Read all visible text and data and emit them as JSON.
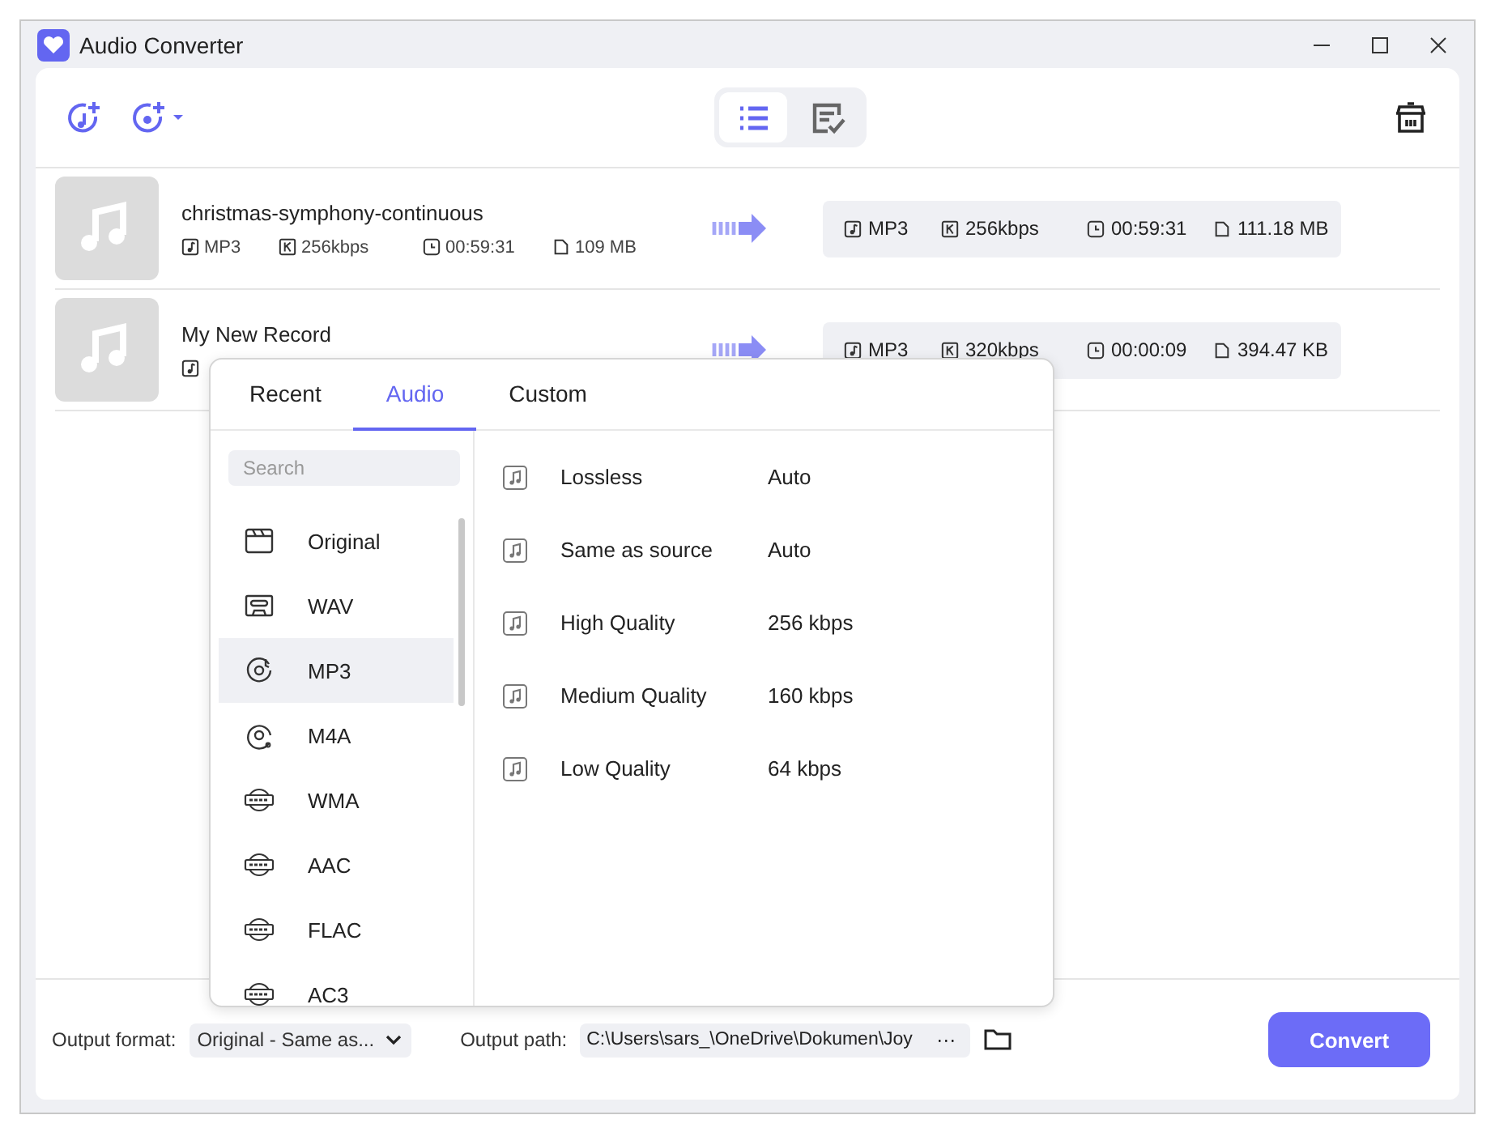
{
  "window": {
    "title": "Audio Converter"
  },
  "view_toggle": [
    {
      "kind": "list",
      "selected": true
    },
    {
      "kind": "tasks",
      "selected": false
    }
  ],
  "files": [
    {
      "name": "christmas-symphony-continuous",
      "source": [
        {
          "kind": "format",
          "text": "MP3"
        },
        {
          "kind": "bitrate",
          "text": "256kbps"
        },
        {
          "kind": "duration",
          "text": "00:59:31"
        },
        {
          "kind": "size",
          "text": "109 MB"
        }
      ],
      "target": [
        {
          "kind": "format",
          "text": "MP3"
        },
        {
          "kind": "bitrate",
          "text": "256kbps"
        },
        {
          "kind": "duration",
          "text": "00:59:31"
        },
        {
          "kind": "size",
          "text": "111.18 MB"
        }
      ]
    },
    {
      "name": "My New Record",
      "source": [
        {
          "kind": "format"
        }
      ],
      "target": [
        {
          "kind": "format",
          "text": "MP3"
        },
        {
          "kind": "bitrate",
          "text": "320kbps"
        },
        {
          "kind": "duration",
          "text": "00:00:09"
        },
        {
          "kind": "size",
          "text": "394.47 KB"
        }
      ]
    }
  ],
  "format_popup": {
    "tabs": [
      {
        "label": "Recent",
        "selected": false
      },
      {
        "label": "Audio",
        "selected": true
      },
      {
        "label": "Custom",
        "selected": false
      }
    ],
    "search": {
      "placeholder": "Search"
    },
    "formats": [
      {
        "label": "Original",
        "kind": "clapper",
        "selected": false
      },
      {
        "label": "WAV",
        "kind": "cassette",
        "selected": false
      },
      {
        "label": "MP3",
        "kind": "disc-note",
        "selected": true
      },
      {
        "label": "M4A",
        "kind": "disc",
        "selected": false
      },
      {
        "label": "WMA",
        "kind": "badge",
        "selected": false
      },
      {
        "label": "AAC",
        "kind": "badge",
        "selected": false
      },
      {
        "label": "FLAC",
        "kind": "badge",
        "selected": false
      },
      {
        "label": "AC3",
        "kind": "badge",
        "selected": false
      }
    ],
    "presets": [
      {
        "name": "Lossless",
        "bitrate": "Auto"
      },
      {
        "name": "Same as source",
        "bitrate": "Auto"
      },
      {
        "name": "High Quality",
        "bitrate": "256 kbps"
      },
      {
        "name": "Medium Quality",
        "bitrate": "160 kbps"
      },
      {
        "name": "Low Quality",
        "bitrate": "64 kbps"
      }
    ]
  },
  "footer": {
    "output_format_label": "Output format:",
    "output_format_value": "Original - Same as...",
    "output_path_label": "Output path:",
    "output_path_value": "C:\\Users\\sars_\\OneDrive\\Dokumen\\Joy",
    "more": "···",
    "convert": "Convert"
  }
}
